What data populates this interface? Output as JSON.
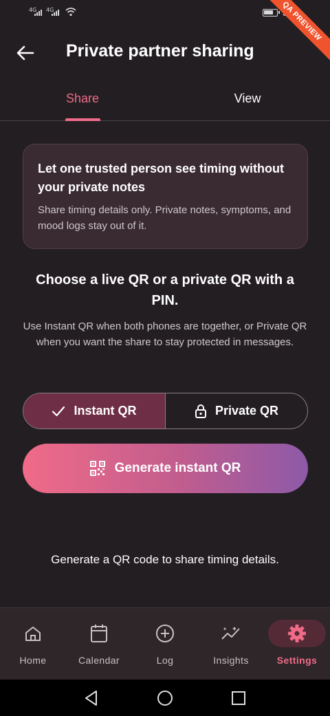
{
  "status_bar": {
    "signal_1": "4G",
    "signal_2": "4G",
    "time": "3:3",
    "ribbon": "QA PREVIEW"
  },
  "app_bar": {
    "title": "Private partner sharing"
  },
  "tabs": [
    {
      "label": "Share",
      "selected": true
    },
    {
      "label": "View",
      "selected": false
    }
  ],
  "info_card": {
    "title": "Let one trusted person see timing without your private notes",
    "body": "Share timing details only. Private notes, symptoms, and mood logs stay out of it."
  },
  "heading": "Choose a live QR or a private QR with a PIN.",
  "subtext": "Use Instant QR when both phones are together, or Private QR when you want the share to stay protected in messages.",
  "mode_toggle": {
    "options": [
      {
        "label": "Instant QR",
        "icon": "check-icon",
        "selected": true
      },
      {
        "label": "Private QR",
        "icon": "lock-icon",
        "selected": false
      }
    ]
  },
  "generate_button": {
    "label": "Generate instant QR",
    "icon": "qr-code-icon"
  },
  "hint": "Generate a QR code to share timing details.",
  "bottom_nav": {
    "items": [
      {
        "label": "Home",
        "icon": "home-icon"
      },
      {
        "label": "Calendar",
        "icon": "calendar-icon"
      },
      {
        "label": "Log",
        "icon": "add-circle-icon"
      },
      {
        "label": "Insights",
        "icon": "insights-icon"
      },
      {
        "label": "Settings",
        "icon": "gear-icon",
        "selected": true
      }
    ]
  },
  "colors": {
    "background": "#231e22",
    "accent": "#f06b88",
    "gradient_end": "#8d5aa8",
    "card": "#3a2a32",
    "nav_bg": "#2e2629"
  }
}
